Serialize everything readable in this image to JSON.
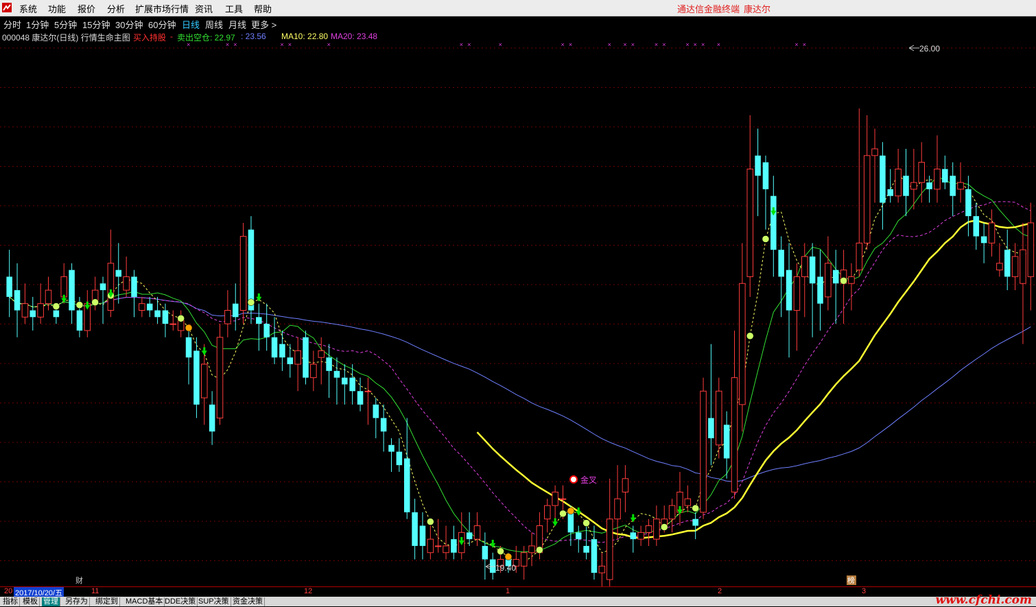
{
  "menu": [
    "系统",
    "功能",
    "报价",
    "分析",
    "扩展市场行情",
    "资讯",
    "工具",
    "帮助"
  ],
  "terminal": {
    "name": "通达信金融终端",
    "stock": "康达尔"
  },
  "periods": [
    "分时",
    "1分钟",
    "5分钟",
    "15分钟",
    "30分钟",
    "60分钟",
    "日线",
    "周线",
    "月线",
    "更多 >"
  ],
  "active_period": "日线",
  "indicator": {
    "code_name": "000048 康达尔(日线) 行情生命主图",
    "buy_label": "买入持股",
    "dash": "-",
    "sell_label": "卖出空仓: 22.97",
    "val2": ": 23.56",
    "ma10": "MA10: 22.80",
    "ma20": "MA20: 23.48"
  },
  "colors": {
    "bull": "#ff3c3c",
    "bear": "#54ffff",
    "ma5": "#ffff66",
    "ma10": "#33e033",
    "ma20": "#e040e0",
    "ma60": "#6f7fff",
    "life": "#ffff33",
    "grid": "#6a0000",
    "buy_marker": "#ffa500",
    "hold_marker": "#ccff66",
    "arrow": "#00e000"
  },
  "chart_data": {
    "type": "candlestick",
    "high_label": "26.00",
    "low_label": "19.40",
    "annotation_cross": "金叉",
    "fin_label": "财",
    "rank_label": "榜",
    "ylim": [
      19.0,
      27.0
    ],
    "candles": [
      [
        23.5,
        23.2,
        23.9,
        22.9
      ],
      [
        23.3,
        23.0,
        23.7,
        22.6
      ],
      [
        22.9,
        23.1,
        23.4,
        22.8
      ],
      [
        23.0,
        22.9,
        23.2,
        22.7
      ],
      [
        22.9,
        23.1,
        23.4,
        22.8
      ],
      [
        23.1,
        23.3,
        23.5,
        23.0
      ],
      [
        23.0,
        22.9,
        23.1,
        22.8
      ],
      [
        23.2,
        23.5,
        23.7,
        23.1
      ],
      [
        23.6,
        23.0,
        23.7,
        22.8
      ],
      [
        23.0,
        22.7,
        23.2,
        22.6
      ],
      [
        22.7,
        23.1,
        23.3,
        22.6
      ],
      [
        23.1,
        23.3,
        23.5,
        23.0
      ],
      [
        23.4,
        23.3,
        23.5,
        22.8
      ],
      [
        23.0,
        23.7,
        24.2,
        22.9
      ],
      [
        23.6,
        23.5,
        24.0,
        23.1
      ],
      [
        23.3,
        23.5,
        23.8,
        23.2
      ],
      [
        23.5,
        23.2,
        23.6,
        22.9
      ],
      [
        23.0,
        23.1,
        23.2,
        22.9
      ],
      [
        23.1,
        23.0,
        23.2,
        22.9
      ],
      [
        23.0,
        22.9,
        23.2,
        22.8
      ],
      [
        23.0,
        22.8,
        23.1,
        22.6
      ],
      [
        22.8,
        22.8,
        23.0,
        22.7
      ],
      [
        22.7,
        22.9,
        23.0,
        22.6
      ],
      [
        22.6,
        22.3,
        22.7,
        21.9
      ],
      [
        22.4,
        21.6,
        22.6,
        21.4
      ],
      [
        21.7,
        22.2,
        22.5,
        21.3
      ],
      [
        21.6,
        21.2,
        21.8,
        21.0
      ],
      [
        21.4,
        22.6,
        22.8,
        21.3
      ],
      [
        22.8,
        23.0,
        23.3,
        22.6
      ],
      [
        23.1,
        22.9,
        23.4,
        22.7
      ],
      [
        23.0,
        24.1,
        24.3,
        22.8
      ],
      [
        24.2,
        23.0,
        24.4,
        22.8
      ],
      [
        22.9,
        22.8,
        23.1,
        22.4
      ],
      [
        22.8,
        22.6,
        23.1,
        22.4
      ],
      [
        22.6,
        22.3,
        22.9,
        22.2
      ],
      [
        22.5,
        22.3,
        22.7,
        22.1
      ],
      [
        22.3,
        22.2,
        22.5,
        22.0
      ],
      [
        22.2,
        22.4,
        22.6,
        21.8
      ],
      [
        22.6,
        22.0,
        22.7,
        21.9
      ],
      [
        22.0,
        22.2,
        22.4,
        21.8
      ],
      [
        22.3,
        22.4,
        22.6,
        21.9
      ],
      [
        22.3,
        22.1,
        22.5,
        21.7
      ],
      [
        22.1,
        22.0,
        22.3,
        21.6
      ],
      [
        22.0,
        21.9,
        22.2,
        21.6
      ],
      [
        22.0,
        21.8,
        22.2,
        21.6
      ],
      [
        21.8,
        21.6,
        22.0,
        21.5
      ],
      [
        21.8,
        21.8,
        22.0,
        21.3
      ],
      [
        21.6,
        21.4,
        21.7,
        21.1
      ],
      [
        21.4,
        21.2,
        21.6,
        20.9
      ],
      [
        21.0,
        20.9,
        21.1,
        20.6
      ],
      [
        20.9,
        20.7,
        21.1,
        20.6
      ],
      [
        20.8,
        20.0,
        21.4,
        19.9
      ],
      [
        20.0,
        19.5,
        20.2,
        19.3
      ],
      [
        19.8,
        19.5,
        20.0,
        19.3
      ],
      [
        19.4,
        19.6,
        19.8,
        19.3
      ],
      [
        19.5,
        19.5,
        19.9,
        19.4
      ],
      [
        19.4,
        19.5,
        19.8,
        19.3
      ],
      [
        19.6,
        19.4,
        19.8,
        19.3
      ],
      [
        19.4,
        19.7,
        20.0,
        19.3
      ],
      [
        19.7,
        19.6,
        20.0,
        19.5
      ],
      [
        19.6,
        19.8,
        20.0,
        19.5
      ],
      [
        19.5,
        19.3,
        19.7,
        19.0
      ],
      [
        19.3,
        19.1,
        19.4,
        19.0
      ],
      [
        19.2,
        19.3,
        19.5,
        19.1
      ],
      [
        19.3,
        19.2,
        19.4,
        19.1
      ],
      [
        19.2,
        19.3,
        19.5,
        19.1
      ],
      [
        19.2,
        19.4,
        19.5,
        19.0
      ],
      [
        19.4,
        19.5,
        19.7,
        19.2
      ],
      [
        19.4,
        19.8,
        20.0,
        19.3
      ],
      [
        19.9,
        20.1,
        20.2,
        19.7
      ],
      [
        20.1,
        20.3,
        20.4,
        19.8
      ],
      [
        20.2,
        20.2,
        20.4,
        19.9
      ],
      [
        20.0,
        19.7,
        20.1,
        19.5
      ],
      [
        19.7,
        19.6,
        19.8,
        19.4
      ],
      [
        19.5,
        19.4,
        19.8,
        19.3
      ],
      [
        19.6,
        19.1,
        19.8,
        19.0
      ],
      [
        19.1,
        19.2,
        19.4,
        18.9
      ],
      [
        19.0,
        19.9,
        20.5,
        18.9
      ],
      [
        19.9,
        20.2,
        20.7,
        19.6
      ],
      [
        20.3,
        20.5,
        20.7,
        20.0
      ],
      [
        19.7,
        19.6,
        19.8,
        19.4
      ],
      [
        19.6,
        19.7,
        19.8,
        19.5
      ],
      [
        19.7,
        19.8,
        19.9,
        19.5
      ],
      [
        19.6,
        19.9,
        20.1,
        19.5
      ],
      [
        19.8,
        19.9,
        20.1,
        19.7
      ],
      [
        19.9,
        20.1,
        20.2,
        19.7
      ],
      [
        20.0,
        20.3,
        20.6,
        19.8
      ],
      [
        20.1,
        20.2,
        20.4,
        20.0
      ],
      [
        19.9,
        19.8,
        20.0,
        19.6
      ],
      [
        20.0,
        21.8,
        22.0,
        19.9
      ],
      [
        21.4,
        21.1,
        22.5,
        20.7
      ],
      [
        21.0,
        21.8,
        22.0,
        20.8
      ],
      [
        21.3,
        20.8,
        21.5,
        20.5
      ],
      [
        20.3,
        22.0,
        22.7,
        20.2
      ],
      [
        21.6,
        23.4,
        24.0,
        21.2
      ],
      [
        23.5,
        25.1,
        25.9,
        23.2
      ],
      [
        25.3,
        25.0,
        25.7,
        24.4
      ],
      [
        25.2,
        24.8,
        25.3,
        24.2
      ],
      [
        24.7,
        23.9,
        25.0,
        23.5
      ],
      [
        23.9,
        23.5,
        24.1,
        22.9
      ],
      [
        23.6,
        23.0,
        24.0,
        22.3
      ],
      [
        23.0,
        23.5,
        23.7,
        22.4
      ],
      [
        23.5,
        23.8,
        24.0,
        22.9
      ],
      [
        23.8,
        23.4,
        24.0,
        22.6
      ],
      [
        23.5,
        23.1,
        23.9,
        22.7
      ],
      [
        23.2,
        23.7,
        24.1,
        23.0
      ],
      [
        23.6,
        23.4,
        23.9,
        22.8
      ],
      [
        23.4,
        23.6,
        23.9,
        22.8
      ],
      [
        23.4,
        23.5,
        23.7,
        23.0
      ],
      [
        23.6,
        24.0,
        26.0,
        23.5
      ],
      [
        24.0,
        25.3,
        25.9,
        23.9
      ],
      [
        25.3,
        25.4,
        25.7,
        24.6
      ],
      [
        25.3,
        24.6,
        25.5,
        24.2
      ],
      [
        24.8,
        24.7,
        25.1,
        24.6
      ],
      [
        24.7,
        25.1,
        25.4,
        24.6
      ],
      [
        25.0,
        24.7,
        25.4,
        24.4
      ],
      [
        24.8,
        24.9,
        25.4,
        24.5
      ],
      [
        24.9,
        25.2,
        25.5,
        24.6
      ],
      [
        24.9,
        24.8,
        25.0,
        24.6
      ],
      [
        24.8,
        25.1,
        25.6,
        24.6
      ],
      [
        25.1,
        24.9,
        25.3,
        24.8
      ],
      [
        25.0,
        24.7,
        25.2,
        24.4
      ],
      [
        24.8,
        24.9,
        25.2,
        24.6
      ],
      [
        24.8,
        24.4,
        25.0,
        24.1
      ],
      [
        24.4,
        24.1,
        24.6,
        23.9
      ],
      [
        24.1,
        24.0,
        24.3,
        23.7
      ],
      [
        24.0,
        24.3,
        24.5,
        23.8
      ],
      [
        23.6,
        23.7,
        24.0,
        23.5
      ],
      [
        23.9,
        23.5,
        24.2,
        23.3
      ],
      [
        23.5,
        23.8,
        24.0,
        23.3
      ],
      [
        23.4,
        23.9,
        24.3,
        22.5
      ],
      [
        23.5,
        24.3,
        24.6,
        23.0
      ]
    ]
  },
  "xaxis": {
    "date_left": "20",
    "date_highlight": "2017/10/20/五",
    "months": [
      "11",
      "12",
      "1",
      "2",
      "3"
    ]
  },
  "tabs": [
    "指标",
    "模板",
    "管理",
    "另存为",
    "绑定到",
    "MACD基本",
    "DDE决策",
    "SUP决策",
    "资金决策"
  ],
  "active_tab": "管理",
  "watermark": "www.cfchi.com"
}
